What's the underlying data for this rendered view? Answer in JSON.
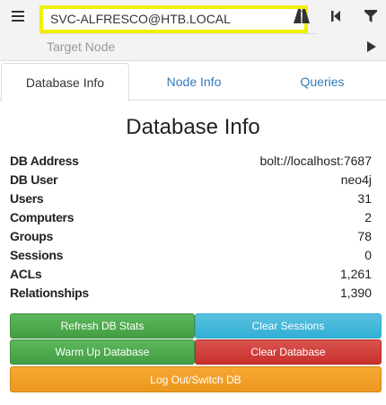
{
  "search": {
    "start_node_value": "SVC-ALFRESCO@HTB.LOCAL",
    "target_node_placeholder": "Target Node"
  },
  "tabs": [
    {
      "label": "Database Info",
      "active": true
    },
    {
      "label": "Node Info",
      "active": false
    },
    {
      "label": "Queries",
      "active": false
    }
  ],
  "main": {
    "title": "Database Info",
    "rows": [
      {
        "label": "DB Address",
        "value": "bolt://localhost:7687"
      },
      {
        "label": "DB User",
        "value": "neo4j"
      },
      {
        "label": "Users",
        "value": "31"
      },
      {
        "label": "Computers",
        "value": "2"
      },
      {
        "label": "Groups",
        "value": "78"
      },
      {
        "label": "Sessions",
        "value": "0"
      },
      {
        "label": "ACLs",
        "value": "1,261"
      },
      {
        "label": "Relationships",
        "value": "1,390"
      }
    ]
  },
  "buttons": {
    "refresh": "Refresh DB Stats",
    "clear_sessions": "Clear Sessions",
    "warm_up": "Warm Up Database",
    "clear_database": "Clear Database",
    "logout": "Log Out/Switch DB"
  },
  "icons": {
    "menu": "hamburger-menu-icon",
    "pathfinding": "road-icon",
    "back": "step-backward-icon",
    "filter": "filter-icon",
    "play": "play-icon"
  },
  "colors": {
    "highlight": "#f0f000",
    "green": "#5cb85c",
    "blue": "#5bc0de",
    "red": "#d9534f",
    "orange": "#f0ad4e",
    "link": "#337ab7"
  }
}
